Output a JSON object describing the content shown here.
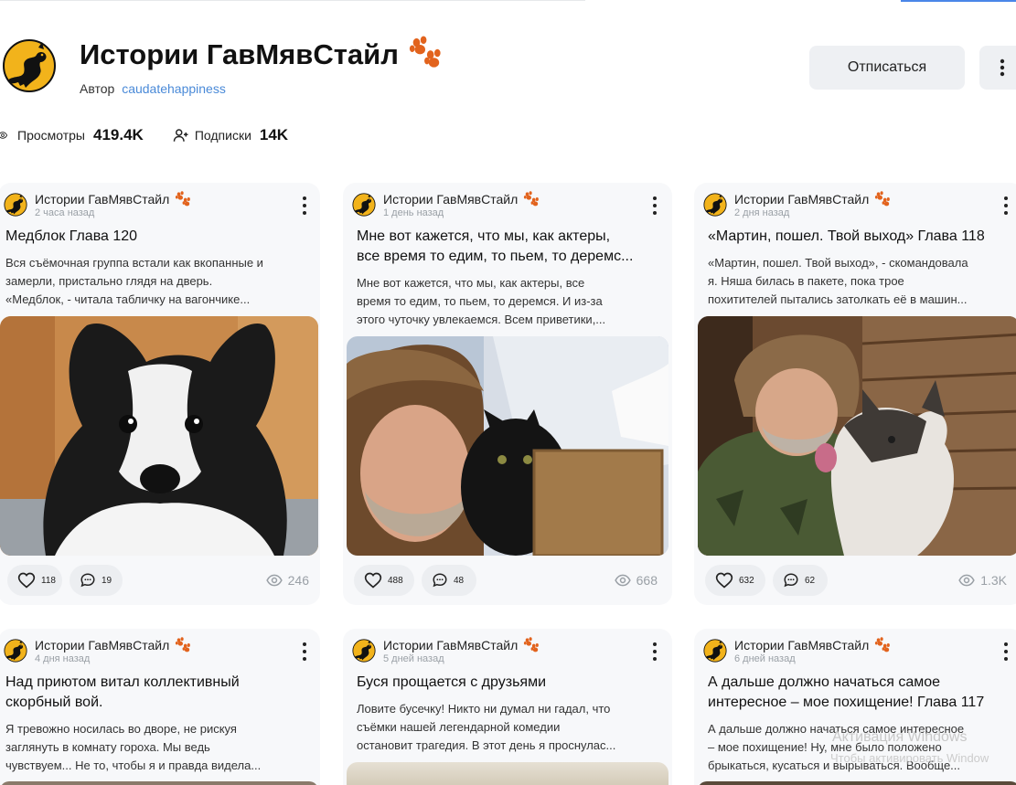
{
  "channel": {
    "title": "Истории ГавМявСтайл",
    "author_label": "Автор",
    "author_name": "caudatehappiness",
    "unsubscribe_label": "Отписаться"
  },
  "stats": {
    "views_label": "Просмотры",
    "views_value": "419.4K",
    "subs_label": "Подписки",
    "subs_value": "14K"
  },
  "cards": [
    {
      "channel": "Истории ГавМявСтайл",
      "time": "2 часа назад",
      "title": "Медблок Глава 120",
      "desc1": "Вся съёмочная группа встали как вкопанные и",
      "desc2": "замерли, пристально глядя на дверь.",
      "desc3": "«Медблок, - читала табличку на вагончике...",
      "likes": "118",
      "comments": "19",
      "views": "246"
    },
    {
      "channel": "Истории ГавМявСтайл",
      "time": "1 день назад",
      "title": "Мне вот кажется, что мы, как актеры,",
      "title2": "все время то едим, то пьем, то деремс...",
      "desc1": "Мне вот кажется, что мы, как актеры, все",
      "desc2": "время то едим, то пьем, то деремся. И из-за",
      "desc3": "этого чуточку увлекаемся. Всем приветики,...",
      "likes": "488",
      "comments": "48",
      "views": "668"
    },
    {
      "channel": "Истории ГавМявСтайл",
      "time": "2 дня назад",
      "title": "«Мартин, пошел. Твой выход» Глава 118",
      "desc1": "«Мартин, пошел. Твой выход», - скомандовала",
      "desc2": "я. Няша билась в пакете, пока трое",
      "desc3": "похитителей пытались затолкать её в машин...",
      "likes": "632",
      "comments": "62",
      "views": "1.3K"
    },
    {
      "channel": "Истории ГавМявСтайл",
      "time": "4 дня назад",
      "title": "Над приютом витал коллективный",
      "title2": "скорбный вой.",
      "desc1": "Я тревожно носилась во дворе, не рискуя",
      "desc2": "заглянуть в комнату гороха. Мы ведь",
      "desc3": "чувствуем... Не то, чтобы я и правда видела..."
    },
    {
      "channel": "Истории ГавМявСтайл",
      "time": "5 дней назад",
      "title": "Буся прощается с друзьями",
      "desc1": "Ловите бусечку! Никто ни думал ни гадал, что",
      "desc2": "съёмки нашей легендарной комедии",
      "desc3": "остановит трагедия. В этот день я проснулас..."
    },
    {
      "channel": "Истории ГавМявСтайл",
      "time": "6 дней назад",
      "title": "А дальше должно начаться самое",
      "title2": "интересное – мое похищение! Глава 117",
      "desc1": "А дальше должно начаться самое интересное",
      "desc2": "– мое похищение! Ну, мне было положено",
      "desc3": "брыкаться, кусаться и вырываться. Вообще..."
    }
  ],
  "watermark": {
    "line1": "Активация Windows",
    "line2": "Чтобы активировать Window"
  },
  "colors": {
    "accent_link": "#4a8ad8",
    "logo_yellow": "#f2b31b",
    "paw_orange": "#e2631d",
    "card_bg": "#f7f8fa",
    "button_bg": "#eef0f3"
  }
}
